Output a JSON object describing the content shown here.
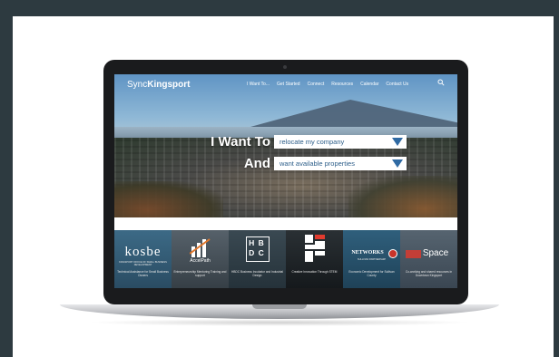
{
  "site": {
    "logo_light": "Sync",
    "logo_bold": "Kingsport",
    "nav": [
      "I Want To...",
      "Get Started",
      "Connect",
      "Resources",
      "Calendar",
      "Contact Us"
    ]
  },
  "hero": {
    "row1_label": "I Want To",
    "row1_value": "relocate my company",
    "row2_label": "And",
    "row2_value": "want available properties"
  },
  "tiles": [
    {
      "title": "kosbe",
      "subtitle": "KINGSPORT OFFICE OF SMALL BUSINESS DEVELOPMENT",
      "caption": "Technical Assistance for Small Business Owners"
    },
    {
      "title": "AccelPath",
      "subtitle": "",
      "caption": "Entrepreneurship Mentoring Training and support"
    },
    {
      "title": "H B D C",
      "subtitle": "",
      "caption": "HBDC Business Incubator and Industrial Design"
    },
    {
      "title": "",
      "subtitle": "",
      "caption": "Creative Innovation Through STEM"
    },
    {
      "title": "NETWORKS",
      "subtitle": "SULLIVAN PARTNERSHIP",
      "caption": "Economic Development for Sullivan County"
    },
    {
      "title": "Space",
      "subtitle": "",
      "caption": "Co-working and shared resources in Downtown Kingsport"
    }
  ],
  "colors": {
    "frame": "#2d3a40",
    "select_text": "#2e5f8a",
    "select_arrow": "#2f6aa3",
    "tiles": [
      "#2f5a77",
      "#3d4a52",
      "#2c3a44",
      "#1b2024",
      "#274e68",
      "#3b4e5c"
    ],
    "networks_red": "#c8342a",
    "space_red": "#d83a2f"
  }
}
